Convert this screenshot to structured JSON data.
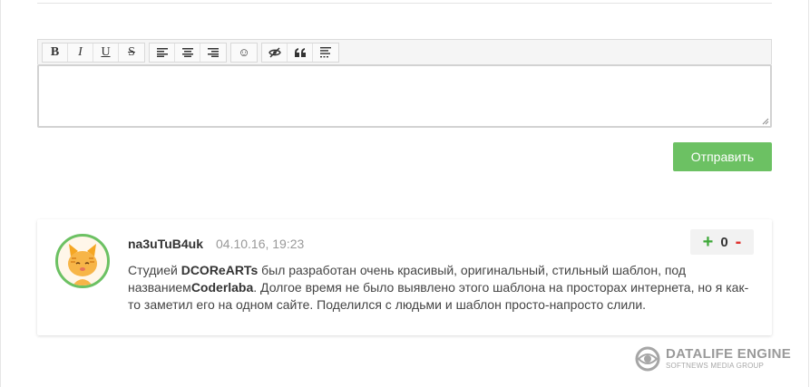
{
  "toolbar": {
    "buttons": {
      "bold": "B",
      "italic": "I",
      "underline": "U",
      "strike": "S",
      "smile": "☺",
      "quote": "❝"
    }
  },
  "form": {
    "submit_label": "Отправить"
  },
  "comment": {
    "author": "na3uTuB4uk",
    "date": "04.10.16, 19:23",
    "text_part1": "Студией ",
    "bold1": "DCOReARTs",
    "text_part2": " был разработан очень красивый, оригинальный, стильный шаблон, под названием",
    "bold2": "Coderlaba",
    "text_part3": ". Долгое время не было выявлено этого шаблона на просторах интернета, но я как-то заметил его на одном сайте. Поделился с людьми и шаблон просто-напросто слили.",
    "rating": {
      "plus": "+",
      "count": "0",
      "minus": "-"
    }
  },
  "footer": {
    "logo_title": "DATALIFE ENGINE",
    "logo_subtitle": "SOFTNEWS MEDIA GROUP"
  },
  "colors": {
    "accent_green": "#6cc163",
    "plus_green": "#3ea838",
    "minus_red": "#e0322f"
  }
}
